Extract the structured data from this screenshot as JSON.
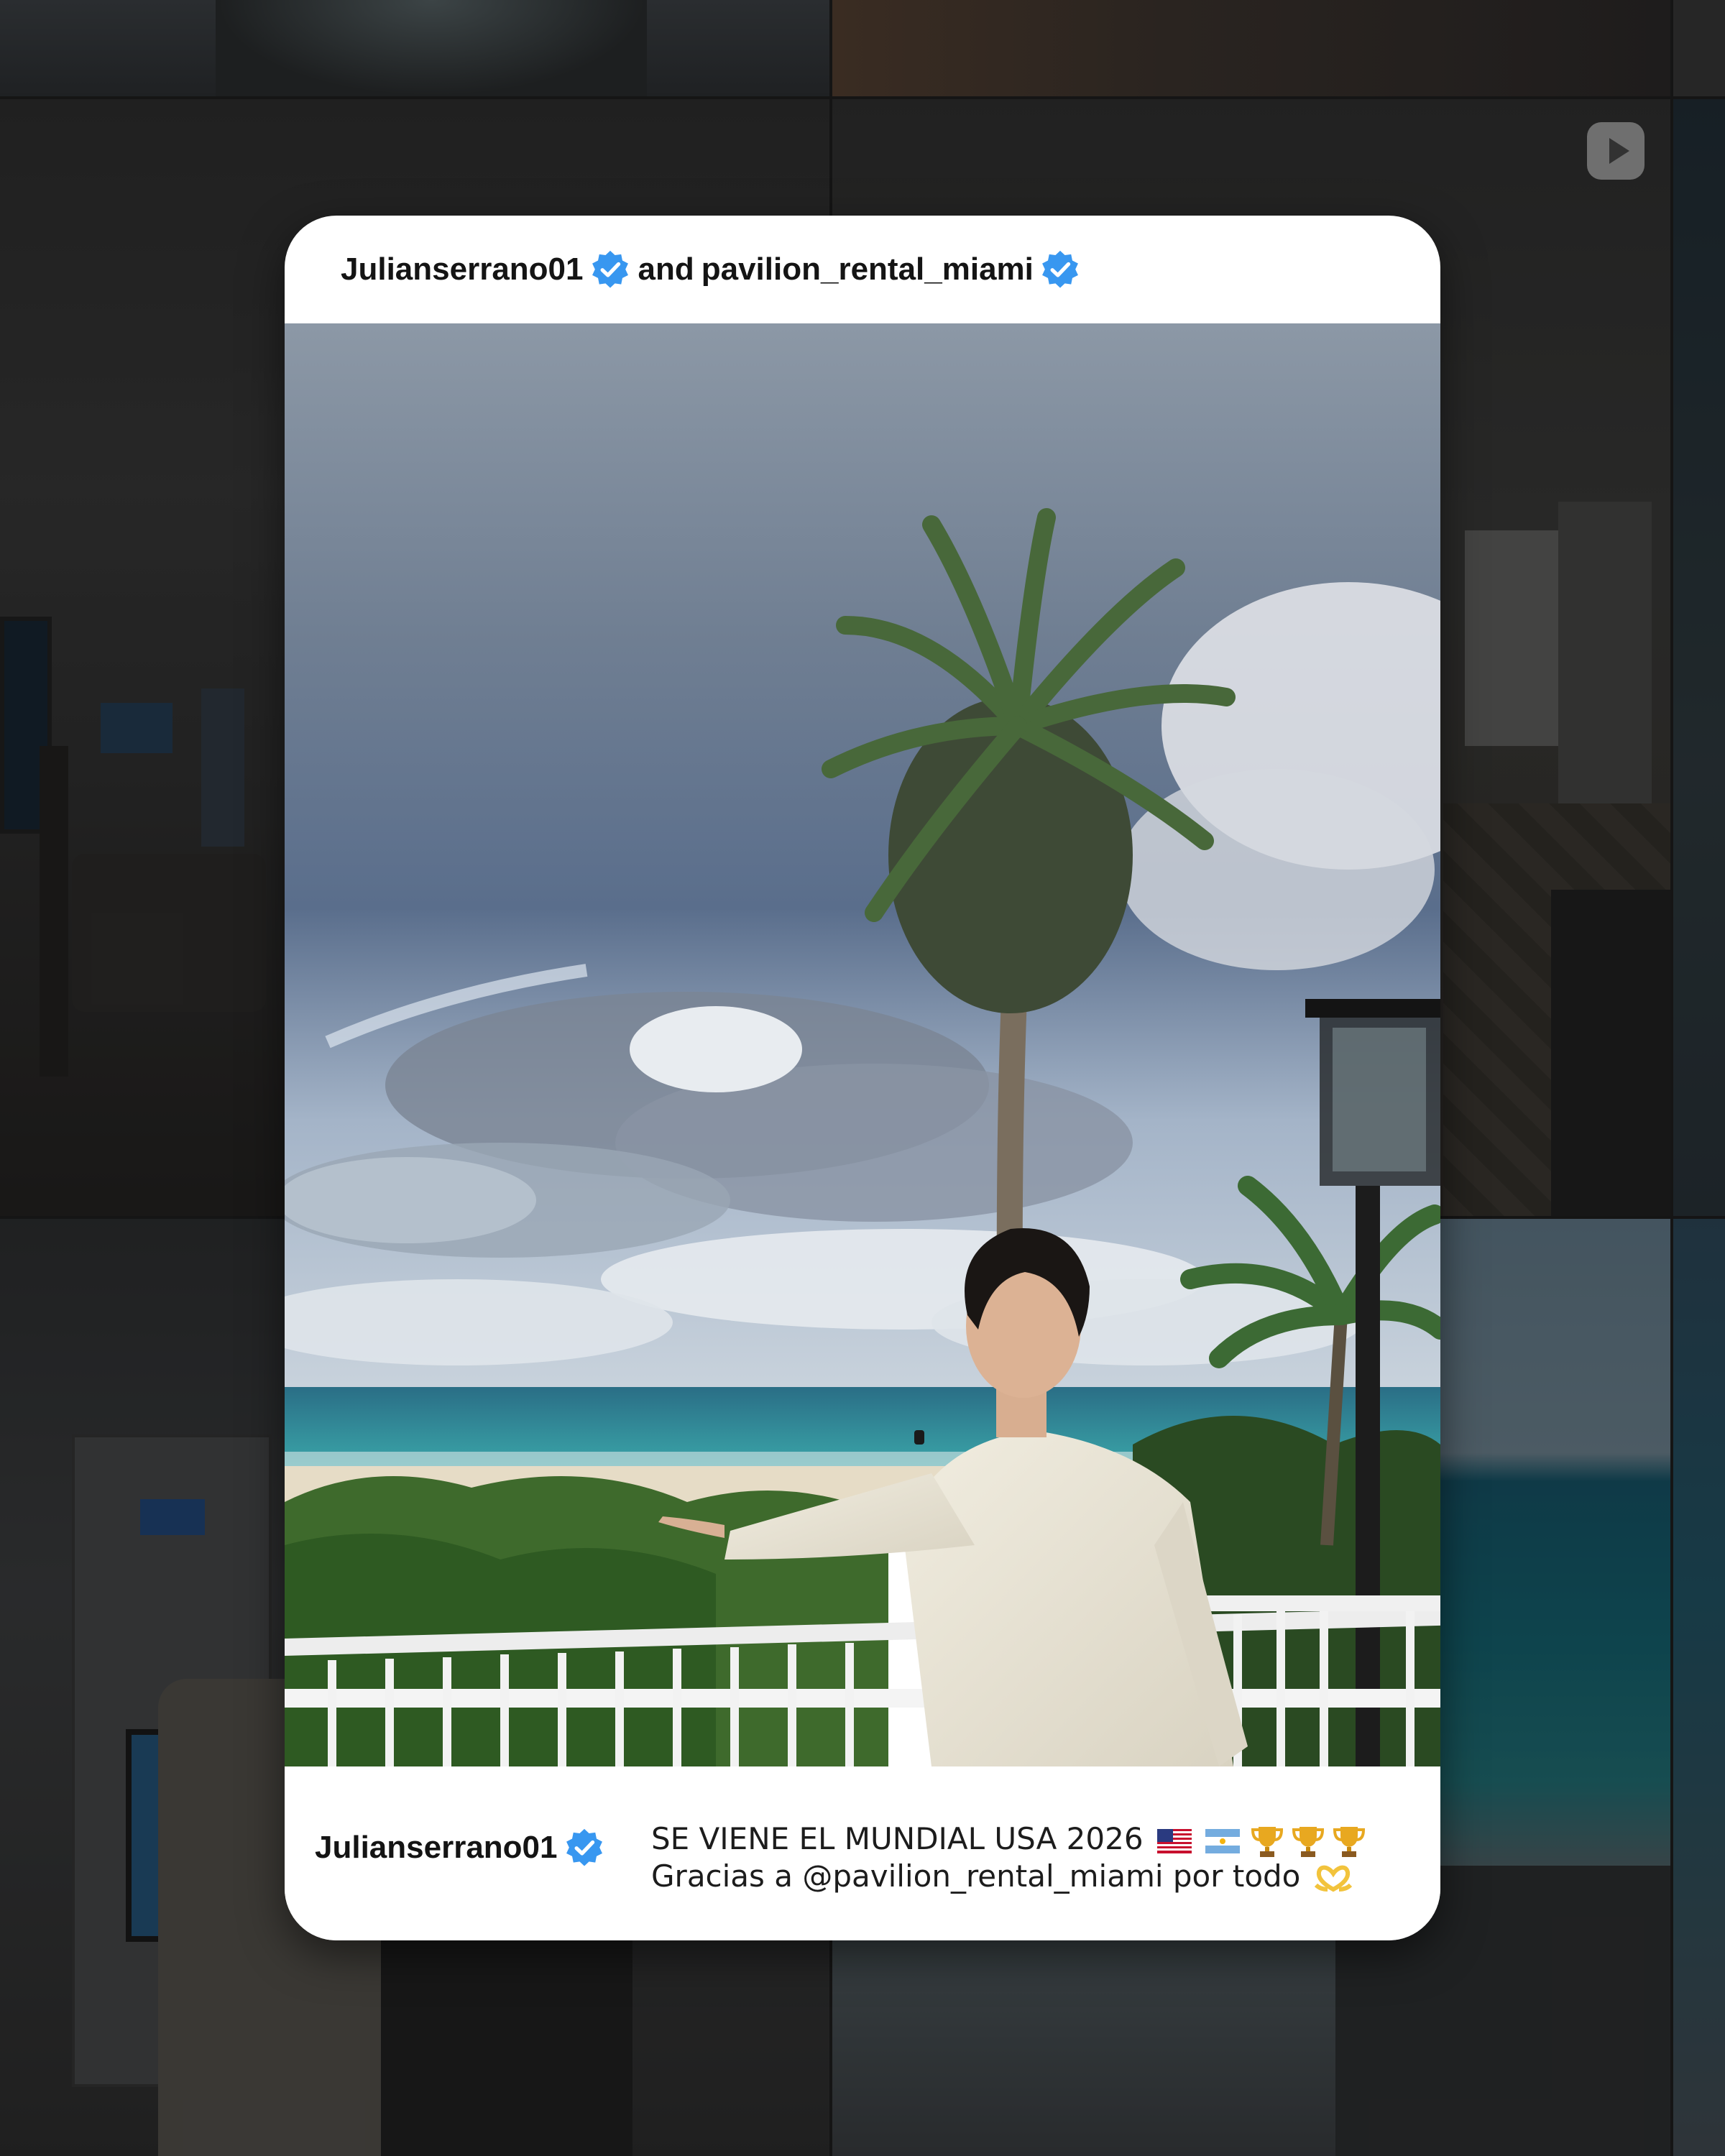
{
  "header": {
    "user1": "Julianserrano01",
    "conjunction": "and",
    "user2": "pavilion_rental_miami"
  },
  "footer": {
    "username": "Julianserrano01",
    "caption_line1": "SE VIENE EL MUNDIAL USA 2026",
    "caption_line2": "Gracias a @pavilion_rental_miami por todo"
  },
  "icons": {
    "verified": "verified-badge-icon",
    "play": "play-icon",
    "emojis_line1": [
      "us-flag-icon",
      "argentina-flag-icon",
      "trophy-icon",
      "trophy-icon",
      "trophy-icon"
    ],
    "emojis_line2": [
      "heart-hands-icon"
    ]
  },
  "colors": {
    "verified_blue": "#3897f0",
    "card_background": "#ffffff",
    "text": "#141414"
  }
}
